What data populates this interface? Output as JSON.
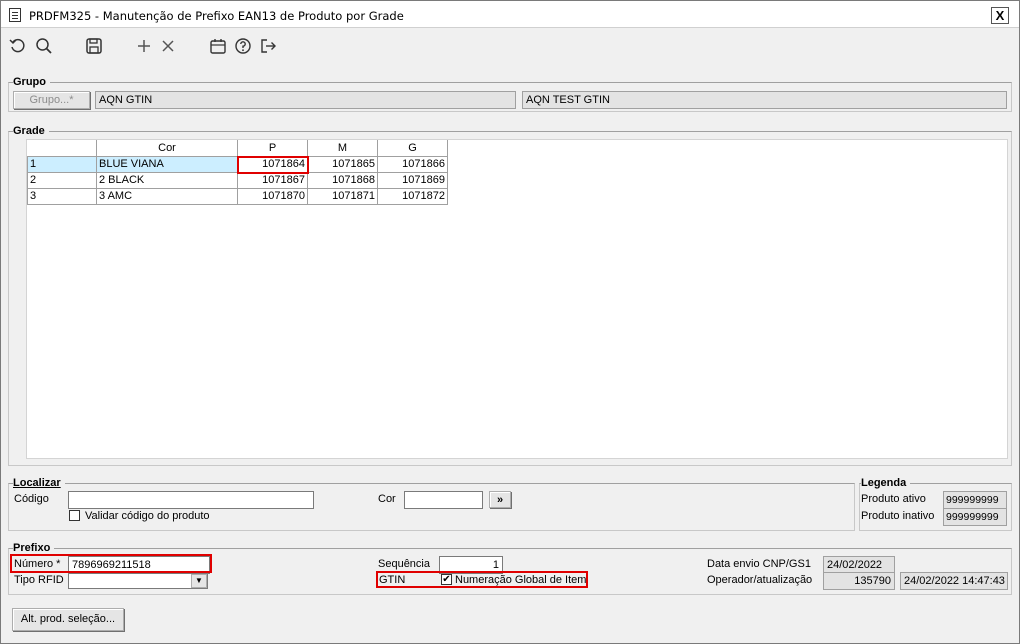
{
  "window": {
    "title": "PRDFM325 - Manutenção de Prefixo EAN13 de Produto por Grade",
    "close_label": "X"
  },
  "toolbar": {
    "icons": [
      "undo-icon",
      "search-icon",
      "save-icon",
      "add-icon",
      "delete-icon",
      "calendar-icon",
      "help-icon",
      "exit-icon"
    ]
  },
  "grupo": {
    "title": "Grupo",
    "button_label": "Grupo...*",
    "code_value": "AQN GTIN",
    "desc_value": "AQN TEST GTIN"
  },
  "grade": {
    "title": "Grade",
    "columns": [
      "",
      "Cor",
      "P",
      "M",
      "G"
    ],
    "rows": [
      [
        "1",
        "BLUE VIANA",
        "1071864",
        "1071865",
        "1071866"
      ],
      [
        "2",
        "2 BLACK",
        "1071867",
        "1071868",
        "1071869"
      ],
      [
        "3",
        "3 AMC",
        "1071870",
        "1071871",
        "1071872"
      ]
    ]
  },
  "localizar": {
    "title": "Localizar",
    "codigo_label": "Código",
    "codigo_value": "",
    "cor_label": "Cor",
    "cor_value": "",
    "go_label": "»",
    "validar_label": "Validar código do produto",
    "validar_checked": false
  },
  "legenda": {
    "title": "Legenda",
    "ativo_label": "Produto ativo",
    "ativo_value": "999999999",
    "inativo_label": "Produto inativo",
    "inativo_value": "999999999"
  },
  "prefixo": {
    "title": "Prefixo",
    "numero_label": "Número *",
    "numero_value": "7896969211518",
    "tipo_rfid_label": "Tipo RFID",
    "tipo_rfid_value": "",
    "sequencia_label": "Sequência",
    "sequencia_value": "1",
    "gtin_label": "GTIN",
    "gtin_check_label": "Numeração Global de Item",
    "gtin_checked": true,
    "data_envio_label": "Data envio CNP/GS1",
    "data_envio_value": "24/02/2022",
    "operador_label": "Operador/atualização",
    "operador_value": "135790",
    "atualizacao_value": "24/02/2022 14:47:43"
  },
  "footer": {
    "alt_button_label": "Alt. prod. seleção..."
  },
  "colors": {
    "highlight_red": "#e00000",
    "selection_blue": "#cceeff"
  }
}
